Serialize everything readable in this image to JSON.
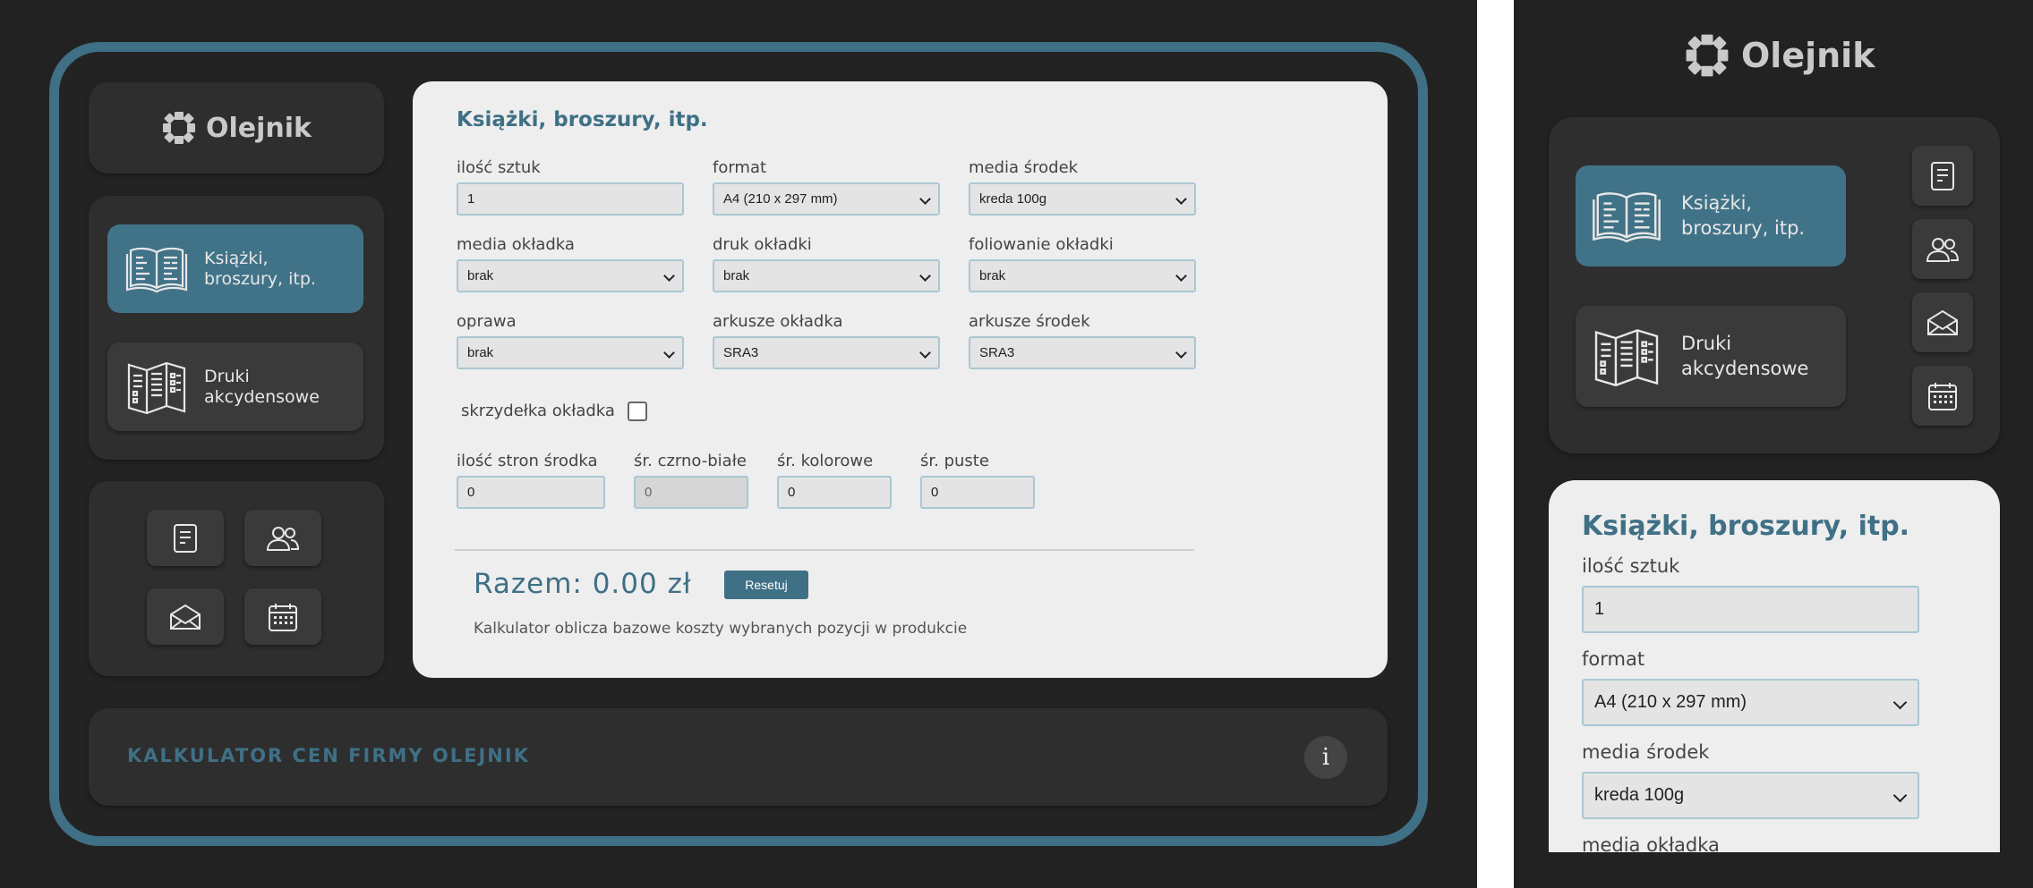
{
  "brand": {
    "name": "Olejnik",
    "accent": "#3f7085"
  },
  "nav": {
    "items": [
      {
        "label": "Książki,\nbroszury, itp.",
        "icon": "book-icon",
        "active": true
      },
      {
        "label": "Druki\nakcydensowe",
        "icon": "brochure-icon",
        "active": false
      }
    ],
    "tools": [
      {
        "icon": "document-icon"
      },
      {
        "icon": "users-icon"
      },
      {
        "icon": "envelope-icon"
      },
      {
        "icon": "calendar-icon"
      }
    ]
  },
  "form": {
    "title": "Książki, broszury, itp.",
    "fields": {
      "ilosc_sztuk": {
        "label": "ilość sztuk",
        "value": "1"
      },
      "format": {
        "label": "format",
        "value": "A4 (210 x 297 mm)"
      },
      "media_srodek": {
        "label": "media środek",
        "value": "kreda 100g"
      },
      "media_okladka": {
        "label": "media okładka",
        "value": "brak"
      },
      "druk_okladki": {
        "label": "druk okładki",
        "value": "brak"
      },
      "foliowanie_okladki": {
        "label": "foliowanie okładki",
        "value": "brak"
      },
      "oprawa": {
        "label": "oprawa",
        "value": "brak"
      },
      "arkusze_okladka": {
        "label": "arkusze okładka",
        "value": "SRA3"
      },
      "arkusze_srodek": {
        "label": "arkusze środek",
        "value": "SRA3"
      },
      "skrzydelka": {
        "label": "skrzydełka okładka",
        "checked": false
      },
      "ilosc_stron": {
        "label": "ilość stron środka",
        "value": "0"
      },
      "sr_czarno_biale": {
        "label": "śr. czrno-białe",
        "value": "0"
      },
      "sr_kolorowe": {
        "label": "śr. kolorowe",
        "value": "0"
      },
      "sr_puste": {
        "label": "śr. puste",
        "value": "0"
      }
    },
    "total": "Razem: 0.00 zł",
    "reset_label": "Resetuj",
    "note": "Kalkulator oblicza bazowe koszty wybranych pozycji w produkcie"
  },
  "footer": {
    "title": "KALKULATOR CEN FIRMY OLEJNIK",
    "info_glyph": "i"
  }
}
